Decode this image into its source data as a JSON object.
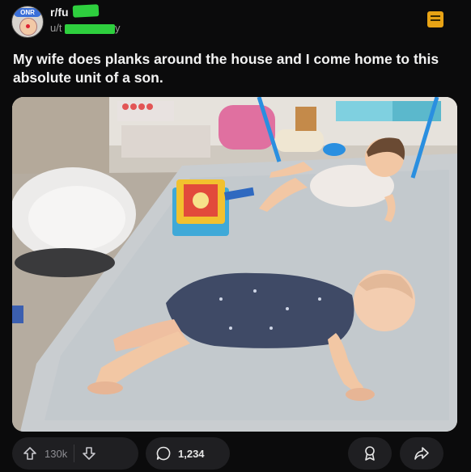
{
  "post": {
    "subreddit": "r/fu",
    "username_prefix": "u/t",
    "username_suffix": "y",
    "title": "My wife does planks around the house and I come home to this absolute unit of a son."
  },
  "avatar": {
    "badge_text": "ONR"
  },
  "actions": {
    "upvotes": "130k",
    "comments": "1,234"
  },
  "icons": {
    "upvote": "upvote-arrow-icon",
    "downvote": "downvote-arrow-icon",
    "comment": "comment-bubble-icon",
    "award": "award-icon",
    "save": "save-icon",
    "share": "share-arrow-icon"
  },
  "colors": {
    "background": "#0b0b0c",
    "redaction": "#2ecf3e",
    "award": "#e8a315"
  }
}
